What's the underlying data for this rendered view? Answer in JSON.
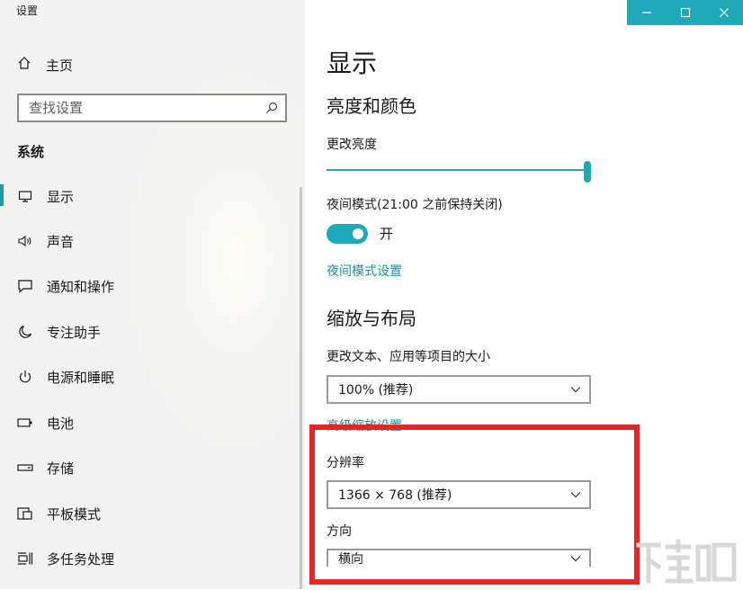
{
  "window": {
    "title": "设置",
    "controls": [
      "minimize-icon",
      "maximize-icon",
      "close-icon"
    ],
    "accent_color": "#1fa8b9"
  },
  "sidebar": {
    "home_label": "主页",
    "search_placeholder": "查找设置",
    "section_title": "系统",
    "items": [
      {
        "label": "显示",
        "icon": "monitor-icon",
        "selected": true
      },
      {
        "label": "声音",
        "icon": "speaker-icon"
      },
      {
        "label": "通知和操作",
        "icon": "notification-icon"
      },
      {
        "label": "专注助手",
        "icon": "moon-icon"
      },
      {
        "label": "电源和睡眠",
        "icon": "power-icon"
      },
      {
        "label": "电池",
        "icon": "battery-icon"
      },
      {
        "label": "存储",
        "icon": "storage-icon"
      },
      {
        "label": "平板模式",
        "icon": "tablet-icon"
      },
      {
        "label": "多任务处理",
        "icon": "multitask-icon"
      }
    ]
  },
  "main": {
    "title": "显示",
    "brightness_section": {
      "heading": "亮度和颜色",
      "brightness_label": "更改亮度",
      "brightness_level": 1.0,
      "night_light_label": "夜间模式(21:00 之前保持关闭)",
      "night_light_state": "开",
      "night_light_settings_link": "夜间模式设置"
    },
    "scale_section": {
      "heading": "缩放与布局",
      "text_size_label": "更改文本、应用等项目的大小",
      "text_size_value": "100% (推荐)",
      "advanced_scaling_link": "高级缩放设置",
      "resolution_label": "分辨率",
      "resolution_value": "1366 × 768 (推荐)",
      "orientation_label": "方向",
      "orientation_value": "横向"
    }
  },
  "annotation": {
    "highlight_color": "#e8242b"
  }
}
